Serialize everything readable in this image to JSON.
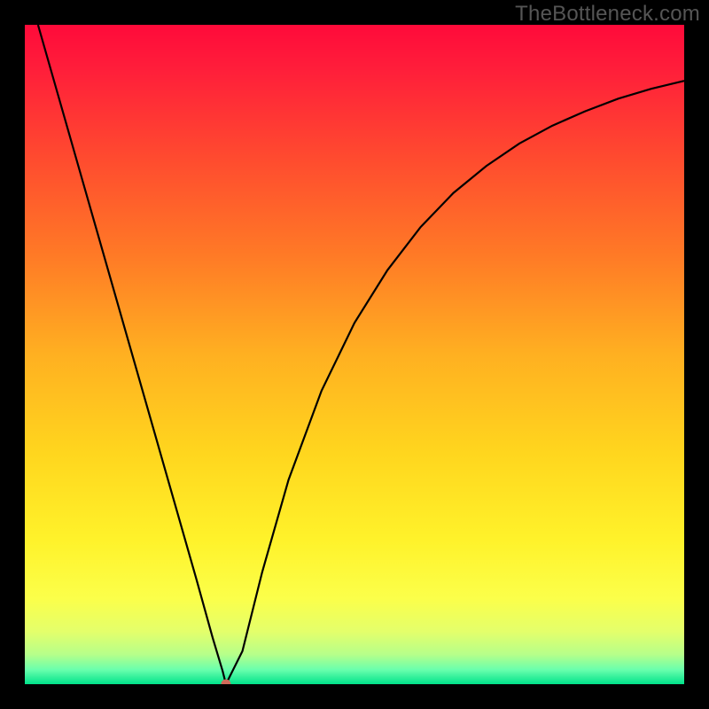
{
  "watermark": "TheBottleneck.com",
  "chart_data": {
    "type": "line",
    "title": "",
    "xlabel": "",
    "ylabel": "",
    "xlim": [
      0,
      1
    ],
    "ylim": [
      0,
      1
    ],
    "grid": false,
    "legend": false,
    "series": [
      {
        "name": "curve",
        "x": [
          0.02,
          0.05,
          0.08,
          0.11,
          0.14,
          0.17,
          0.2,
          0.23,
          0.26,
          0.285,
          0.3,
          0.305,
          0.33,
          0.36,
          0.4,
          0.45,
          0.5,
          0.55,
          0.6,
          0.65,
          0.7,
          0.75,
          0.8,
          0.85,
          0.9,
          0.95,
          1.0
        ],
        "y": [
          1.0,
          0.895,
          0.79,
          0.685,
          0.58,
          0.475,
          0.37,
          0.265,
          0.16,
          0.07,
          0.02,
          0.0,
          0.05,
          0.17,
          0.31,
          0.445,
          0.548,
          0.628,
          0.693,
          0.745,
          0.786,
          0.82,
          0.847,
          0.869,
          0.888,
          0.903,
          0.915
        ]
      }
    ],
    "minimum_marker": {
      "x": 0.305,
      "y": 0.0
    },
    "gradient": {
      "stops": [
        {
          "offset": 0.0,
          "color": "#ff0a3a"
        },
        {
          "offset": 0.07,
          "color": "#ff1f3a"
        },
        {
          "offset": 0.2,
          "color": "#ff4a2f"
        },
        {
          "offset": 0.35,
          "color": "#ff7a26"
        },
        {
          "offset": 0.5,
          "color": "#ffb021"
        },
        {
          "offset": 0.65,
          "color": "#ffd61e"
        },
        {
          "offset": 0.78,
          "color": "#fff22a"
        },
        {
          "offset": 0.87,
          "color": "#fbff4a"
        },
        {
          "offset": 0.92,
          "color": "#e4ff6b"
        },
        {
          "offset": 0.955,
          "color": "#b6ff8a"
        },
        {
          "offset": 0.978,
          "color": "#6affad"
        },
        {
          "offset": 1.0,
          "color": "#00e28a"
        }
      ]
    },
    "marker_color": "#d06a5a",
    "curve_color": "#000000"
  }
}
